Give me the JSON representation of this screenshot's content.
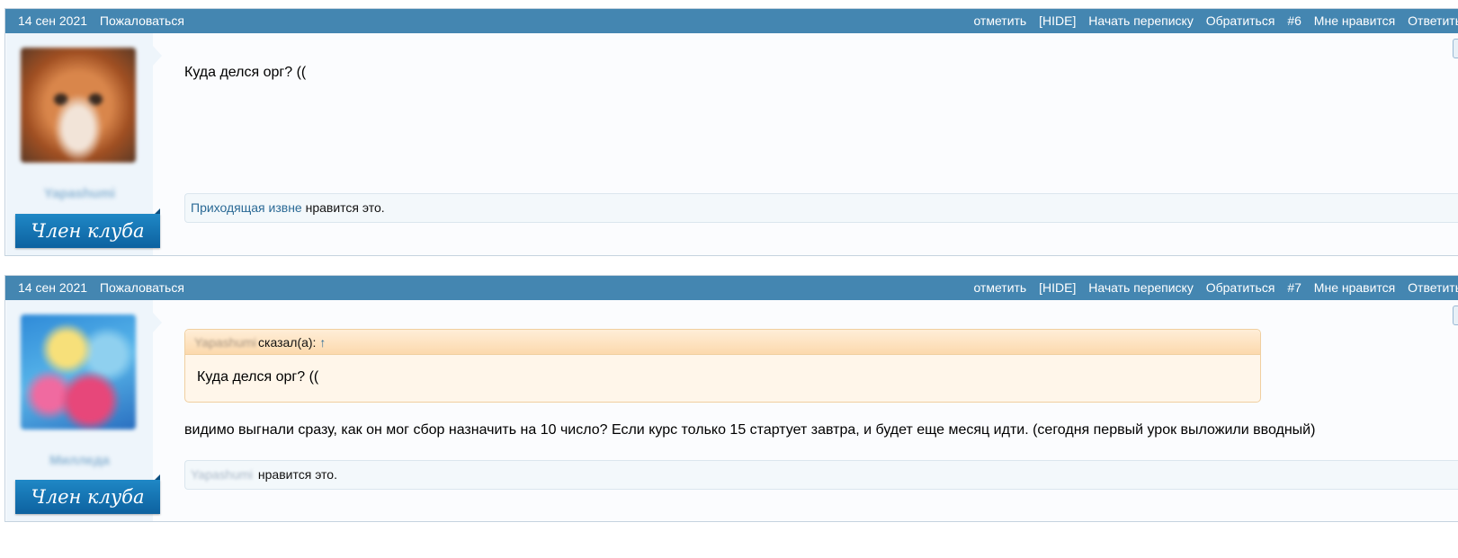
{
  "posts": [
    {
      "date": "14 сен 2021",
      "report": "Пожаловаться",
      "actions": [
        "отметить",
        "[HIDE]",
        "Начать переписку",
        "Обратиться",
        "#6",
        "Мне нравится",
        "Ответить"
      ],
      "author": {
        "name": "Yapashumi",
        "rank": "Член клуба",
        "avatar": "fox-avatar"
      },
      "message": "Куда делся орг? ((",
      "likes": {
        "liker": "Приходящая извне",
        "suffix": "нравится это."
      }
    },
    {
      "date": "14 сен 2021",
      "report": "Пожаловаться",
      "actions": [
        "отметить",
        "[HIDE]",
        "Начать переписку",
        "Обратиться",
        "#7",
        "Мне нравится",
        "Ответить"
      ],
      "author": {
        "name": "Милледа",
        "rank": "Член клуба",
        "avatar": "flowers-avatar"
      },
      "quote": {
        "author": "Yapashumi",
        "said": "сказал(а):",
        "arrow": "↑",
        "text": "Куда делся орг? (("
      },
      "message": "видимо выгнали сразу, как он мог сбор назначить на 10 число? Если курс только 15 стартует завтра, и будет еще месяц идти. (сегодня первый урок выложили вводный)",
      "likes": {
        "liker": "Yapashumi",
        "suffix": "нравится это."
      }
    }
  ]
}
